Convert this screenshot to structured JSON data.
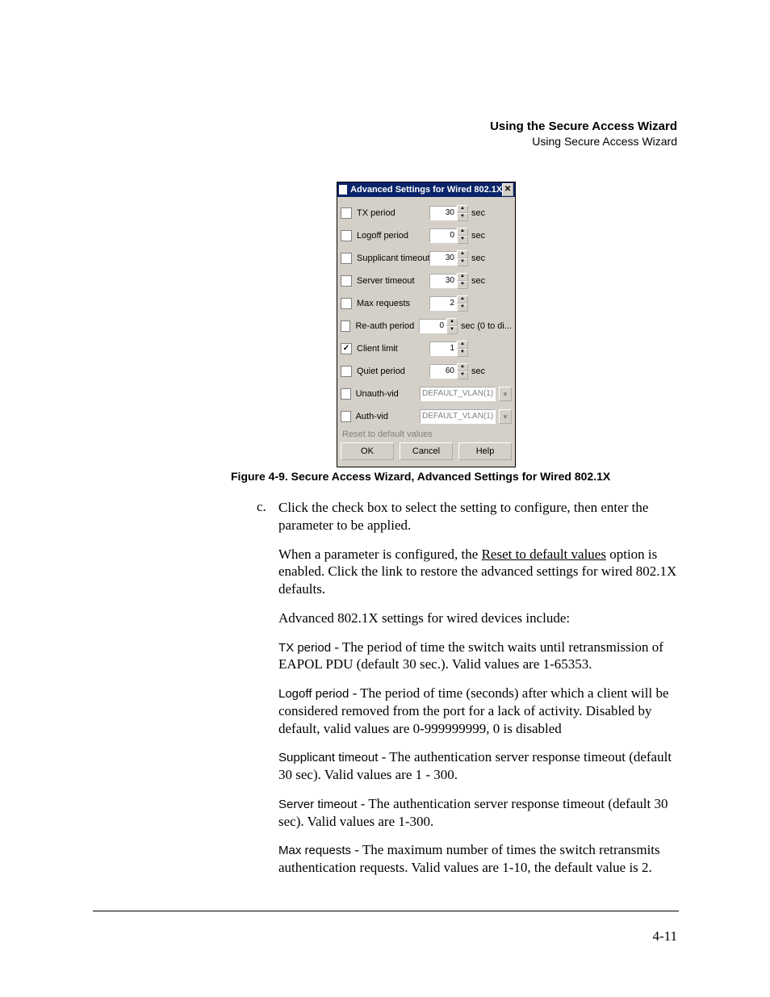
{
  "runhead": {
    "h1": "Using the Secure Access Wizard",
    "h2": "Using Secure Access Wizard"
  },
  "dialog": {
    "title": "Advanced Settings for Wired 802.1X",
    "close_glyph": "✕",
    "rows": {
      "tx": {
        "label": "TX period",
        "checked": false,
        "value": "30",
        "unit": "sec"
      },
      "logoff": {
        "label": "Logoff period",
        "checked": false,
        "value": "0",
        "unit": "sec"
      },
      "supp": {
        "label": "Supplicant timeout",
        "checked": false,
        "value": "30",
        "unit": "sec"
      },
      "server": {
        "label": "Server timeout",
        "checked": false,
        "value": "30",
        "unit": "sec"
      },
      "maxreq": {
        "label": "Max requests",
        "checked": false,
        "value": "2",
        "unit": ""
      },
      "reauth": {
        "label": "Re-auth period",
        "checked": false,
        "value": "0",
        "unit": "sec (0 to di..."
      },
      "client": {
        "label": "Client limit",
        "checked": true,
        "value": "1",
        "unit": ""
      },
      "quiet": {
        "label": "Quiet period",
        "checked": false,
        "value": "60",
        "unit": "sec"
      },
      "unauth": {
        "label": "Unauth-vid",
        "checked": false,
        "value": "DEFAULT_VLAN(1)"
      },
      "auth": {
        "label": "Auth-vid",
        "checked": false,
        "value": "DEFAULT_VLAN(1)"
      }
    },
    "reset_link": "Reset to default values",
    "buttons": {
      "ok": "OK",
      "cancel": "Cancel",
      "help": "Help"
    }
  },
  "caption": "Figure 4-9. Secure Access Wizard, Advanced Settings for Wired 802.1X",
  "list_marker": "c.",
  "body": {
    "p1": "Click the check box to select the setting to configure, then enter the parameter to be applied.",
    "p2a": "When a parameter is configured, the ",
    "p2_link": "Reset to default values",
    "p2b": " option is enabled. Click the link to restore the advanced settings for wired 802.1X defaults.",
    "p3": "Advanced 802.1X settings for wired devices include:",
    "tx_term": "TX period",
    "tx_desc": " - The period of time the switch waits until retransmission of EAPOL PDU (default 30 sec.). Valid values are 1-65353.",
    "logoff_term": "Logoff period",
    "logoff_desc": " - The period of time (seconds) after which a client will be considered removed from the port for a lack of activity. Disabled by default, valid values are 0-999999999, 0 is disabled",
    "supp_term": "Supplicant timeout",
    "supp_desc": " - The authentication server response timeout (default 30 sec). Valid values are 1 - 300.",
    "server_term": "Server timeout",
    "server_desc": " - The authentication server response timeout (default 30 sec). Valid values are 1-300.",
    "max_term": "Max requests",
    "max_desc": " - The maximum number of times the switch retransmits authentication requests. Valid values are 1-10, the default value is 2."
  },
  "pagenum": "4-11"
}
